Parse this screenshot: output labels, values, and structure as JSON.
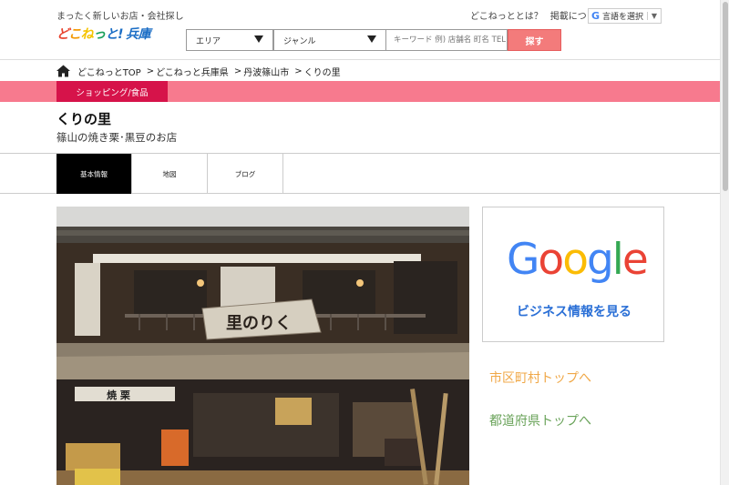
{
  "header": {
    "tagline": "まったく新しいお店・会社探し",
    "logo": {
      "part1": "ど",
      "part2": "こ",
      "part3": "ね",
      "part4": "っ",
      "part5": "と!",
      "pref": "兵庫"
    },
    "links": [
      "どこねっととは？",
      "掲載について"
    ],
    "translate": {
      "label": "言語を選択",
      "arrow": "▼"
    }
  },
  "search": {
    "area_label": "エリア",
    "genre_label": "ジャンル",
    "keyword_placeholder": "キーワード 例) 店舗名 町名 TEL",
    "button_label": "探す"
  },
  "breadcrumb": [
    "どこねっとTOP",
    "どこねっと兵庫県",
    "丹波篠山市",
    "くりの里"
  ],
  "breadcrumb_sep": ">",
  "category": "ショッピング/食品",
  "shop": {
    "name": "くりの里",
    "subtitle": "篠山の焼き栗･黒豆のお店"
  },
  "tabs": [
    {
      "label": "基本情報",
      "active": true
    },
    {
      "label": "地図",
      "active": false
    },
    {
      "label": "ブログ",
      "active": false
    }
  ],
  "photo": {
    "sign_text": "里のりく",
    "shop_sign": "焼 栗"
  },
  "google_box": {
    "letters": [
      "G",
      "o",
      "o",
      "g",
      "l",
      "e"
    ],
    "caption": "ビジネス情報を見る"
  },
  "side_links": {
    "city": "市区町村トップへ",
    "pref": "都道府県トップへ"
  },
  "colors": {
    "category_band": "#f77a8e",
    "category_label": "#d6134a",
    "search_button": "#f37b7b",
    "city_link": "#f0a848",
    "pref_link": "#6aa35a"
  }
}
